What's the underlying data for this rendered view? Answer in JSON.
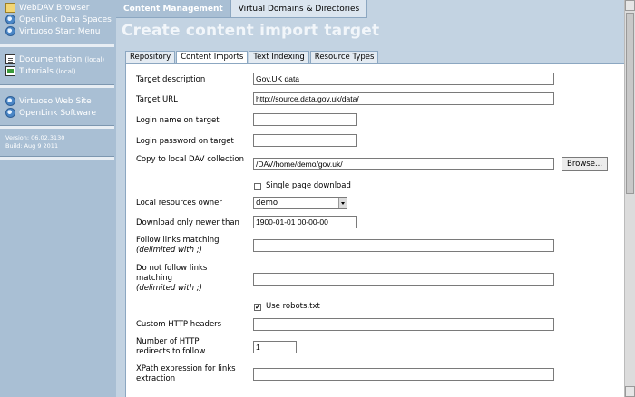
{
  "sidebar": {
    "links": [
      {
        "label": "WebDAV Browser",
        "icon": "folder-icon"
      },
      {
        "label": "OpenLink Data Spaces",
        "icon": "globe-icon"
      },
      {
        "label": "Virtuoso Start Menu",
        "icon": "globe-icon"
      }
    ],
    "docs": [
      {
        "label": "Documentation",
        "note": "(local)",
        "icon": "document-icon"
      },
      {
        "label": "Tutorials",
        "note": "(local)",
        "icon": "tutorial-icon"
      }
    ],
    "sites": [
      {
        "label": "Virtuoso Web Site",
        "icon": "globe-icon"
      },
      {
        "label": "OpenLink Software",
        "icon": "globe-icon"
      }
    ],
    "version": "Version: 06.02.3130",
    "build": "Build: Aug 9 2011"
  },
  "topnav": {
    "items": [
      "Content Management",
      "Virtual Domains & Directories"
    ],
    "active": 0
  },
  "page_title": "Create content import target",
  "tabs": {
    "items": [
      "Repository",
      "Content Imports",
      "Text Indexing",
      "Resource Types"
    ],
    "active": 1
  },
  "form": {
    "target_description": {
      "label": "Target description",
      "value": "Gov.UK data"
    },
    "target_url": {
      "label": "Target URL",
      "value": "http://source.data.gov.uk/data/"
    },
    "login_name": {
      "label": "Login name on target",
      "value": ""
    },
    "login_password": {
      "label": "Login password on target",
      "value": ""
    },
    "copy_to_dav": {
      "label": "Copy to local DAV collection",
      "value": "/DAV/home/demo/gov.uk/",
      "browse": "Browse..."
    },
    "single_page": {
      "label": "Single page download",
      "checked": false
    },
    "owner": {
      "label": "Local resources owner",
      "value": "demo"
    },
    "newer_than": {
      "label": "Download only newer than",
      "value": "1900-01-01 00-00-00"
    },
    "follow_links": {
      "label": "Follow links matching",
      "note": "(delimited with ;)",
      "value": ""
    },
    "no_follow_links": {
      "label": "Do not follow links matching",
      "note": "(delimited with ;)",
      "value": ""
    },
    "robots": {
      "label": "Use robots.txt",
      "checked": true,
      "mark": "✔"
    },
    "custom_headers": {
      "label": "Custom HTTP headers",
      "value": ""
    },
    "redirects": {
      "label": "Number of HTTP redirects to follow",
      "value": "1"
    },
    "xpath": {
      "label": "XPath expression for links extraction",
      "value": ""
    }
  }
}
